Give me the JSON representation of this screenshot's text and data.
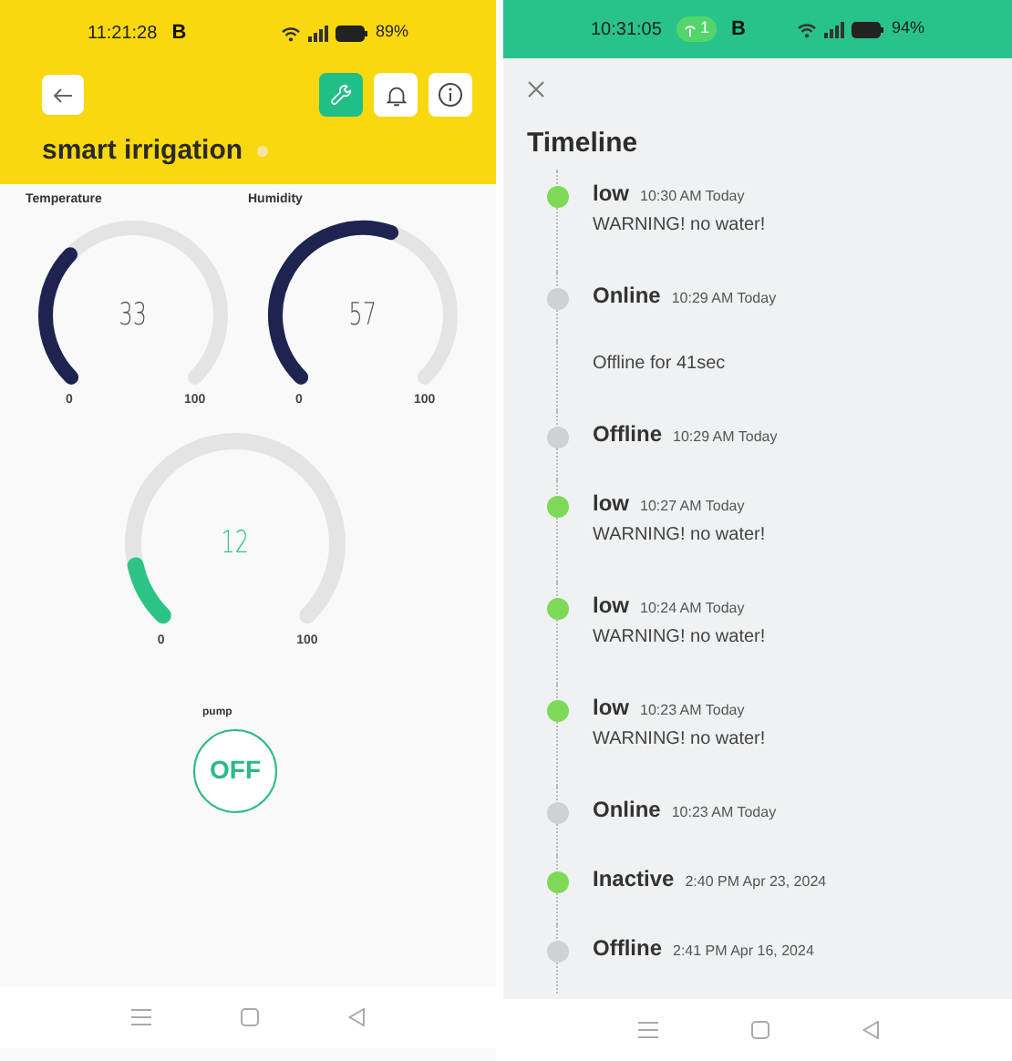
{
  "left_phone": {
    "status_bar": {
      "time": "11:21:28",
      "badge": "B",
      "battery": "89%"
    },
    "header": {
      "title": "smart irrigation",
      "tools": [
        {
          "kind": "wrench",
          "selected": true
        },
        {
          "kind": "bell",
          "selected": false
        },
        {
          "kind": "info",
          "selected": false
        }
      ]
    },
    "gauges": [
      {
        "label": "Temperature",
        "value": "33",
        "min": "0",
        "max": "100",
        "color": "#1e2350"
      },
      {
        "label": "Humidity",
        "value": "57",
        "min": "0",
        "max": "100",
        "color": "#1e2350"
      },
      {
        "value": "12",
        "min": "0",
        "max": "100",
        "color": "#2cc486"
      }
    ],
    "pump": {
      "label": "pump",
      "state": "OFF"
    }
  },
  "right_phone": {
    "status_bar": {
      "time": "10:31:05",
      "hotspot_count": "1",
      "badge": "B",
      "battery": "94%"
    },
    "title": "Timeline",
    "events": [
      {
        "kind": "event",
        "name": "low",
        "time": "10:30 AM Today",
        "message": "WARNING! no water!",
        "color": "#7ed957"
      },
      {
        "kind": "event",
        "name": "Online",
        "time": "10:29 AM Today",
        "color": "#cfd2d4"
      },
      {
        "kind": "note",
        "message": "Offline for 41sec"
      },
      {
        "kind": "event",
        "name": "Offline",
        "time": "10:29 AM Today",
        "color": "#cfd2d4"
      },
      {
        "kind": "event",
        "name": "low",
        "time": "10:27 AM Today",
        "message": "WARNING! no water!",
        "color": "#7ed957"
      },
      {
        "kind": "event",
        "name": "low",
        "time": "10:24 AM Today",
        "message": "WARNING! no water!",
        "color": "#7ed957"
      },
      {
        "kind": "event",
        "name": "low",
        "time": "10:23 AM Today",
        "message": "WARNING! no water!",
        "color": "#7ed957"
      },
      {
        "kind": "event",
        "name": "Online",
        "time": "10:23 AM Today",
        "color": "#cfd2d4"
      },
      {
        "kind": "event",
        "name": "Inactive",
        "time": "2:40 PM Apr 23, 2024",
        "color": "#7ed957"
      },
      {
        "kind": "event",
        "name": "Offline",
        "time": "2:41 PM Apr 16, 2024",
        "color": "#cfd2d4"
      }
    ]
  }
}
